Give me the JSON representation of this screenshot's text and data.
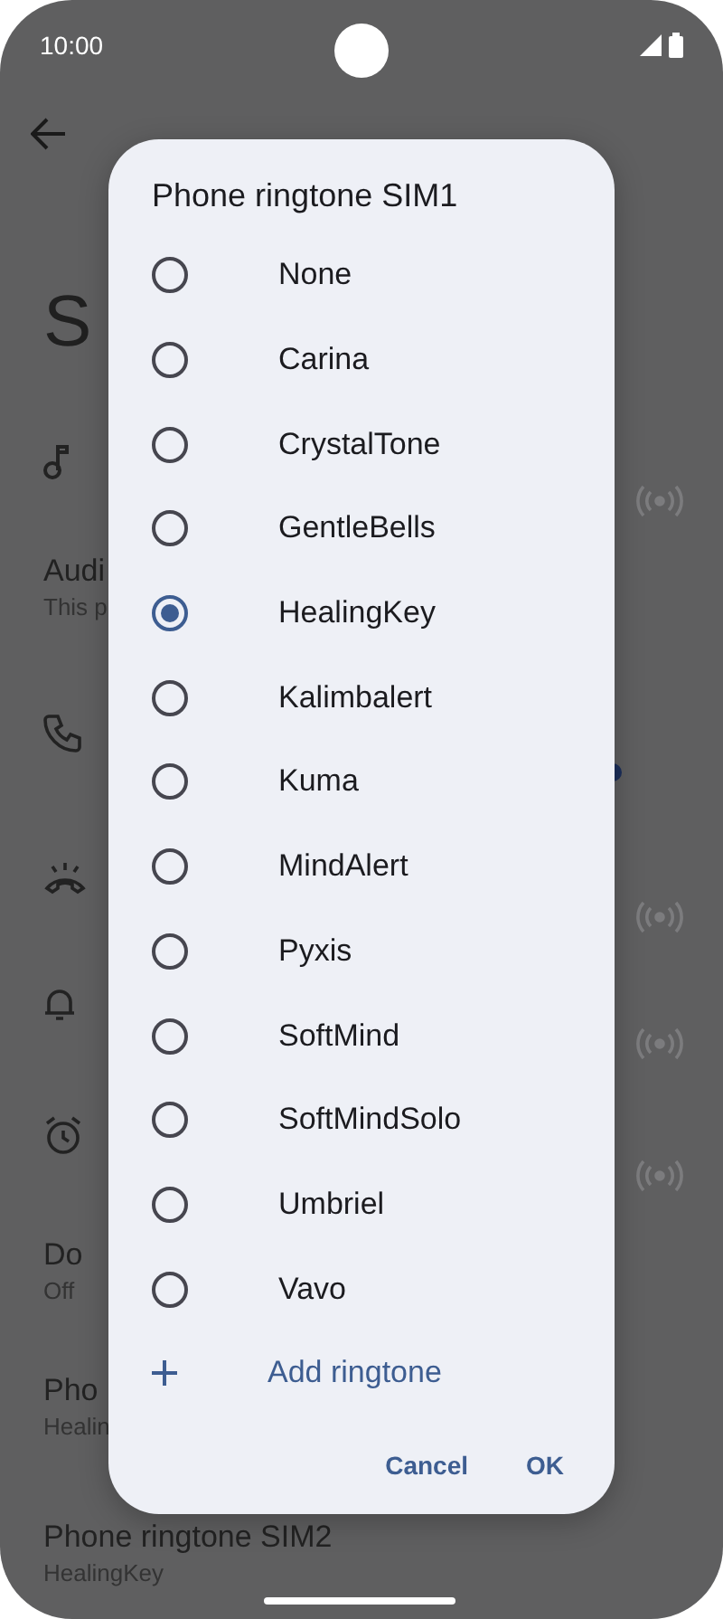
{
  "status_bar": {
    "time": "10:00"
  },
  "settings": {
    "title": "S",
    "audio": {
      "title": "Audi",
      "subtitle": "This p"
    },
    "dnd": {
      "title": "Do",
      "subtitle": "Off"
    },
    "sim1": {
      "title": "Pho",
      "subtitle": "Healin"
    },
    "sim2": {
      "title": "Phone ringtone SIM2",
      "subtitle": "HealingKey"
    }
  },
  "dialog": {
    "title": "Phone ringtone SIM1",
    "options": [
      {
        "label": "None",
        "selected": false
      },
      {
        "label": "Carina",
        "selected": false
      },
      {
        "label": "CrystalTone",
        "selected": false
      },
      {
        "label": "GentleBells",
        "selected": false
      },
      {
        "label": "HealingKey",
        "selected": true
      },
      {
        "label": "Kalimbalert",
        "selected": false
      },
      {
        "label": "Kuma",
        "selected": false
      },
      {
        "label": "MindAlert",
        "selected": false
      },
      {
        "label": "Pyxis",
        "selected": false
      },
      {
        "label": "SoftMind",
        "selected": false
      },
      {
        "label": "SoftMindSolo",
        "selected": false
      },
      {
        "label": "Umbriel",
        "selected": false
      },
      {
        "label": "Vavo",
        "selected": false
      }
    ],
    "add_label": "Add ringtone",
    "buttons": [
      "Cancel",
      "OK"
    ]
  }
}
